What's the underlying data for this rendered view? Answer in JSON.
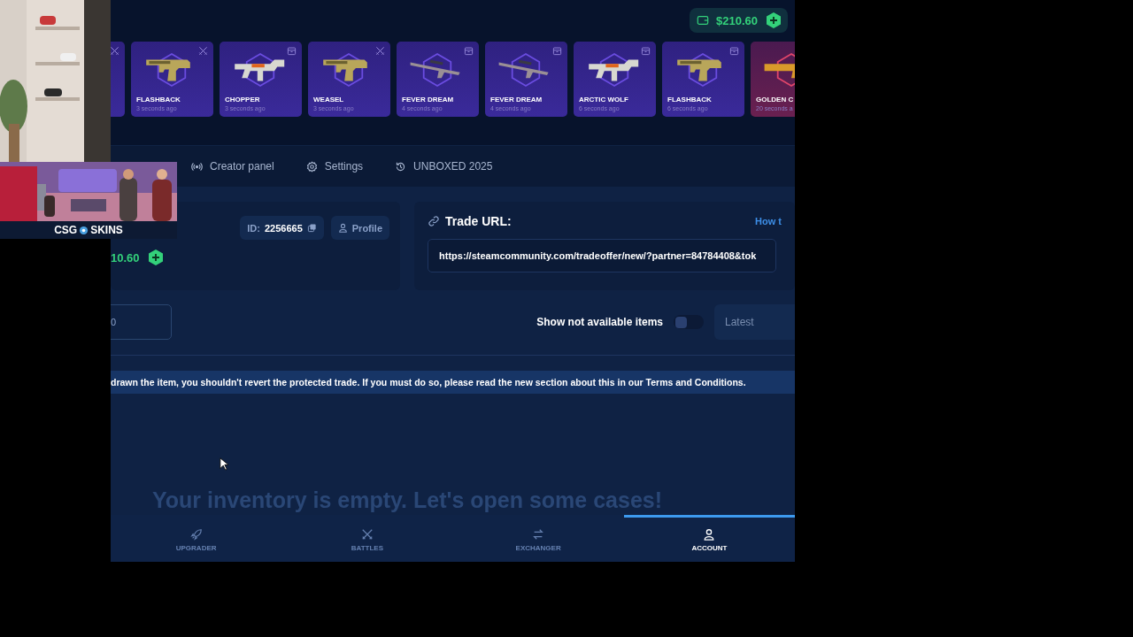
{
  "header": {
    "balance": "$210.60"
  },
  "live_drops": [
    {
      "kind": "battle"
    },
    {
      "kind": "battle",
      "name": "FLASHBACK",
      "time": "3 seconds ago"
    },
    {
      "kind": "case",
      "name": "CHOPPER",
      "time": "3 seconds ago"
    },
    {
      "kind": "battle",
      "name": "WEASEL",
      "time": "3 seconds ago"
    },
    {
      "kind": "case",
      "name": "FEVER DREAM",
      "time": "4 seconds ago"
    },
    {
      "kind": "case",
      "name": "FEVER DREAM",
      "time": "4 seconds ago"
    },
    {
      "kind": "case",
      "name": "ARCTIC WOLF",
      "time": "6 seconds ago"
    },
    {
      "kind": "case",
      "name": "FLASHBACK",
      "time": "6 seconds ago"
    },
    {
      "kind": "covert",
      "name": "GOLDEN C",
      "time": "20 seconds a"
    }
  ],
  "account_nav": [
    {
      "label": "Creator panel"
    },
    {
      "label": "Settings"
    },
    {
      "label": "UNBOXED 2025"
    }
  ],
  "profile": {
    "id_label": "ID:",
    "id": "2256665",
    "profile_button": "Profile",
    "balance": "10.60"
  },
  "trade_url": {
    "title": "Trade URL:",
    "help_link": "How t",
    "value": "https://steamcommunity.com/tradeoffer/new/?partner=84784408&tok"
  },
  "filters": {
    "search_value": "0",
    "toggle_label": "Show not available items",
    "toggle_on": false,
    "sort": "Latest"
  },
  "notice": "drawn the item, you shouldn't revert the protected trade. If you must do so, please read the new section about this in our Terms and Conditions.",
  "empty_message": "Your inventory is empty. Let's open some cases!",
  "bottom_nav": [
    {
      "label": "UPGRADER",
      "selected": false
    },
    {
      "label": "BATTLES",
      "selected": false
    },
    {
      "label": "EXCHANGER",
      "selected": false
    },
    {
      "label": "ACCOUNT",
      "selected": true
    }
  ],
  "stream_overlay": {
    "logo_left": "CSG",
    "logo_right": "SKINS"
  }
}
